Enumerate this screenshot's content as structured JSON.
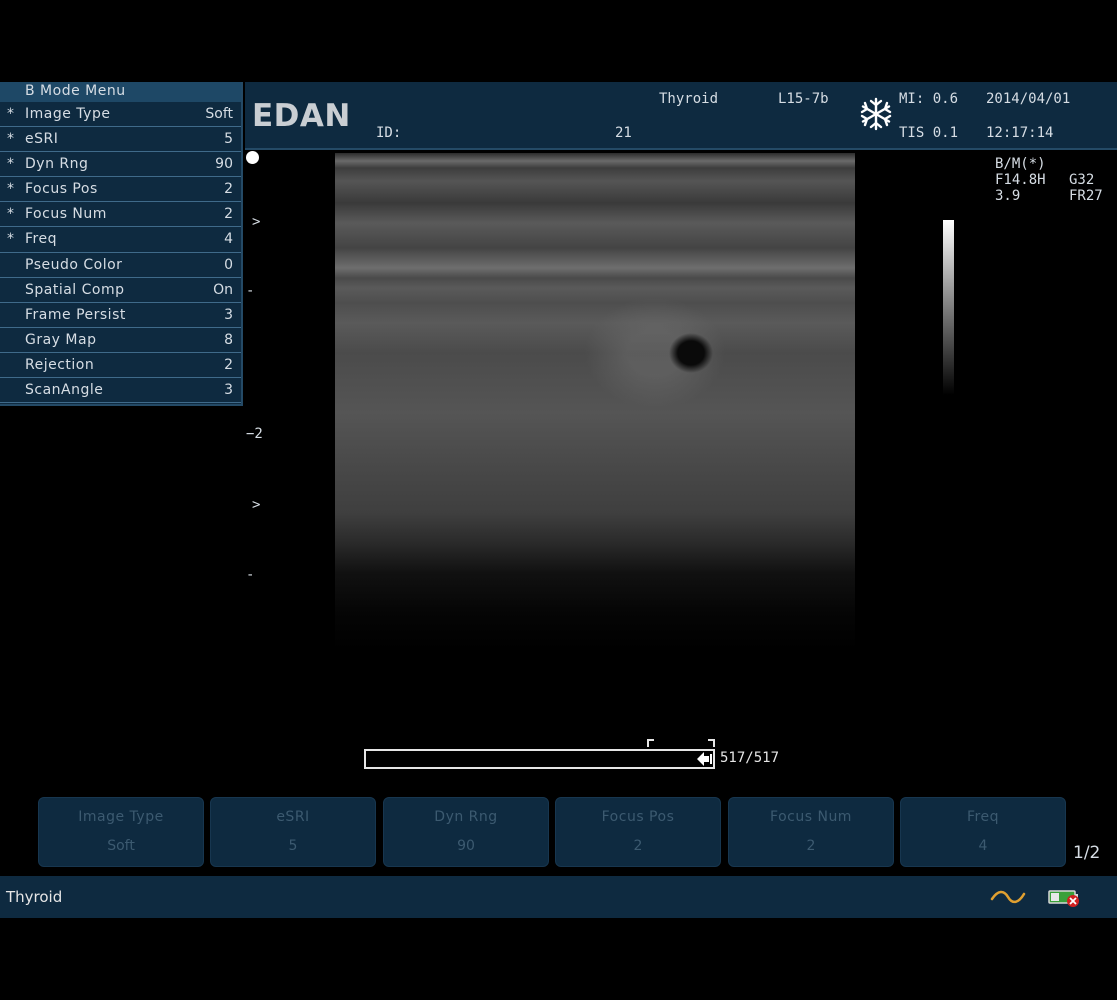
{
  "menu": {
    "title": "B Mode Menu",
    "items": [
      {
        "star": "*",
        "label": "Image Type",
        "value": "Soft"
      },
      {
        "star": "*",
        "label": "eSRI",
        "value": "5"
      },
      {
        "star": "*",
        "label": "Dyn Rng",
        "value": "90"
      },
      {
        "star": "*",
        "label": "Focus Pos",
        "value": "2"
      },
      {
        "star": "*",
        "label": "Focus Num",
        "value": "2"
      },
      {
        "star": "*",
        "label": "Freq",
        "value": "4"
      },
      {
        "star": "",
        "label": "Pseudo Color",
        "value": "0"
      },
      {
        "star": "",
        "label": "Spatial Comp",
        "value": "On"
      },
      {
        "star": "",
        "label": "Frame Persist",
        "value": "3"
      },
      {
        "star": "",
        "label": "Gray Map",
        "value": "8"
      },
      {
        "star": "",
        "label": "Rejection",
        "value": "2"
      },
      {
        "star": "",
        "label": "ScanAngle",
        "value": "3"
      }
    ]
  },
  "header": {
    "logo": "EDAN",
    "id_label": "ID:",
    "id_value": "21",
    "exam": "Thyroid",
    "probe": "L15-7b",
    "mi": "MI: 0.6",
    "tis": "TIS 0.1",
    "date": "2014/04/01",
    "time": "12:17:14",
    "freeze_icon": "snowflake-icon"
  },
  "image_info": {
    "mode": "B/M(*)",
    "freq": "F14.8H",
    "gain": "G32",
    "depth": "3.9",
    "frame_rate": "FR27"
  },
  "depth_scale": {
    "marker_top": ">",
    "tick1": "-",
    "label2": "−2",
    "marker_mid": ">",
    "tick3": "-"
  },
  "cine": {
    "count": "517/517",
    "position": 1.0
  },
  "soft_buttons": [
    {
      "label": "Image Type",
      "value": "Soft"
    },
    {
      "label": "eSRI",
      "value": "5"
    },
    {
      "label": "Dyn Rng",
      "value": "90"
    },
    {
      "label": "Focus Pos",
      "value": "2"
    },
    {
      "label": "Focus Num",
      "value": "2"
    },
    {
      "label": "Freq",
      "value": "4"
    }
  ],
  "page_indicator": "1/2",
  "status": {
    "text": "Thyroid",
    "icons": [
      "wave-icon",
      "battery-icon"
    ],
    "colors": {
      "wave": "#e0a030",
      "battery_ok": "#3aa03a",
      "battery_error": "#d02020"
    }
  }
}
